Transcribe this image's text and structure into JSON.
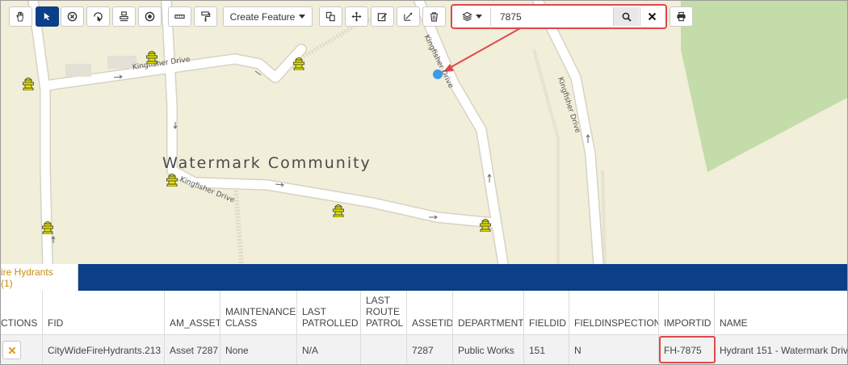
{
  "toolbar": {
    "tools": [
      {
        "name": "pan-tool",
        "icon": "hand-icon"
      },
      {
        "name": "select-tool",
        "icon": "cursor-arrow-icon",
        "active": true
      },
      {
        "name": "clear-selection-tool",
        "icon": "circle-x-icon"
      },
      {
        "name": "identify-tool",
        "icon": "rotate-pointer-icon"
      },
      {
        "name": "layer-properties-tool",
        "icon": "stack-tool-icon"
      },
      {
        "name": "buffer-tool",
        "icon": "target-icon"
      },
      {
        "name": "measure-tool",
        "icon": "ruler-icon"
      },
      {
        "name": "markup-tool",
        "icon": "paint-roller-icon"
      }
    ],
    "create_feature_label": "Create Feature",
    "edit_tools": [
      {
        "name": "copy-feature-tool",
        "icon": "copy-icon"
      },
      {
        "name": "move-feature-tool",
        "icon": "move-arrows-icon"
      },
      {
        "name": "edit-feature-tool",
        "icon": "edit-icon"
      },
      {
        "name": "reshape-tool",
        "icon": "reshape-icon"
      },
      {
        "name": "delete-feature-tool",
        "icon": "trash-icon"
      }
    ]
  },
  "search": {
    "layer_icon": "layers-icon",
    "value": "7875",
    "search_icon": "magnifier-icon",
    "clear_icon": "close-icon"
  },
  "print_icon": "printer-icon",
  "map": {
    "community_label": "Watermark Community",
    "street_labels": [
      "Kingfisher Drive",
      "Kingfisher Drive",
      "Kingfisher Drive",
      "Kingfisher Drive"
    ],
    "colors": {
      "background": "#f1eed9",
      "park": "#c4dbaa",
      "road": "#ffffff",
      "road_edge": "#d7d3c3",
      "location_marker": "#3d9be9",
      "annotation": "#e0474c"
    }
  },
  "results": {
    "tab_label": "ire Hydrants (1)",
    "columns": [
      "CTIONS",
      "FID",
      "AM_ASSET",
      "MAINTENANCE CLASS",
      "LAST PATROLLED",
      "LAST ROUTE PATROL",
      "ASSETID",
      "DEPARTMENT",
      "FIELDID",
      "FIELDINSPECTION",
      "IMPORTID",
      "NAME"
    ],
    "rows": [
      {
        "action_icon": "close-icon",
        "FID": "CityWideFireHydrants.213",
        "AM_ASSET": "Asset 7287",
        "MAINTENANCE_CLASS": "None",
        "LAST_PATROLLED": "N/A",
        "LAST_ROUTE_PATROL": "",
        "ASSETID": "7287",
        "DEPARTMENT": "Public Works",
        "FIELDID": "151",
        "FIELDINSPECTION": "N",
        "IMPORTID": "FH-7875",
        "NAME": "Hydrant 151 - Watermark Driv"
      }
    ],
    "colors": {
      "tab_bar": "#0b3f87",
      "tab_text": "#c68d12",
      "row_bg": "#f2f2f2"
    }
  }
}
